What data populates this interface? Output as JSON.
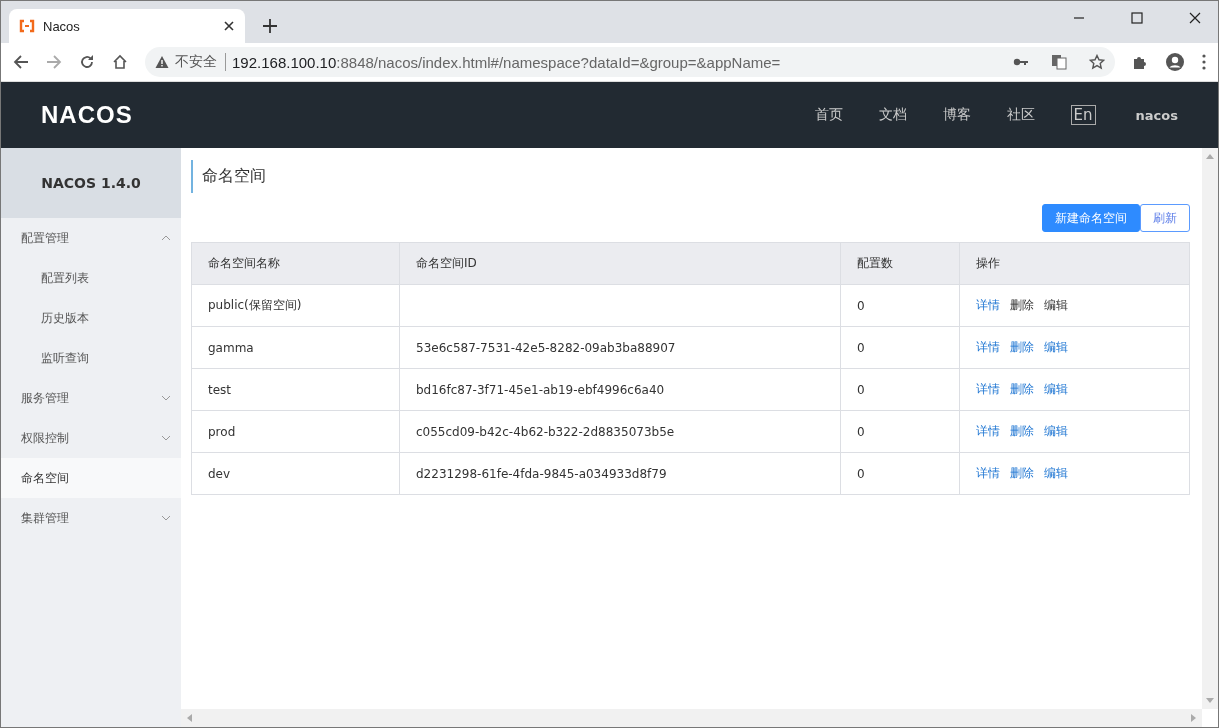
{
  "browser": {
    "tab_title": "Nacos",
    "security_label": "不安全",
    "url_host": "192.168.100.10",
    "url_rest": ":8848/nacos/index.html#/namespace?dataId=&group=&appName="
  },
  "header": {
    "logo": "NACOS",
    "nav": [
      "首页",
      "文档",
      "博客",
      "社区"
    ],
    "language": "En",
    "user": "nacos"
  },
  "sidebar": {
    "version": "NACOS 1.4.0",
    "items": [
      {
        "label": "配置管理",
        "expanded": true,
        "selected": false,
        "children": [
          {
            "label": "配置列表",
            "selected": false
          },
          {
            "label": "历史版本",
            "selected": false
          },
          {
            "label": "监听查询",
            "selected": false
          }
        ]
      },
      {
        "label": "服务管理",
        "expanded": false,
        "selected": false
      },
      {
        "label": "权限控制",
        "expanded": false,
        "selected": false
      },
      {
        "label": "命名空间",
        "selected": true
      },
      {
        "label": "集群管理",
        "expanded": false,
        "selected": false
      }
    ]
  },
  "page": {
    "title": "命名空间",
    "buttons": [
      {
        "label": "新建命名空间",
        "kind": "primary"
      },
      {
        "label": "刷新",
        "kind": "normal"
      }
    ]
  },
  "table": {
    "columns": [
      "命名空间名称",
      "命名空间ID",
      "配置数",
      "操作"
    ],
    "rows": [
      {
        "name": "public(保留空间)",
        "id": "",
        "count": "0",
        "actions": [
          {
            "label": "详情",
            "disabled": false
          },
          {
            "label": "删除",
            "disabled": true
          },
          {
            "label": "编辑",
            "disabled": true
          }
        ]
      },
      {
        "name": "gamma",
        "id": "53e6c587-7531-42e5-8282-09ab3ba88907",
        "count": "0",
        "actions": [
          {
            "label": "详情",
            "disabled": false
          },
          {
            "label": "删除",
            "disabled": false
          },
          {
            "label": "编辑",
            "disabled": false
          }
        ]
      },
      {
        "name": "test",
        "id": "bd16fc87-3f71-45e1-ab19-ebf4996c6a40",
        "count": "0",
        "actions": [
          {
            "label": "详情",
            "disabled": false
          },
          {
            "label": "删除",
            "disabled": false
          },
          {
            "label": "编辑",
            "disabled": false
          }
        ]
      },
      {
        "name": "prod",
        "id": "c055cd09-b42c-4b62-b322-2d8835073b5e",
        "count": "0",
        "actions": [
          {
            "label": "详情",
            "disabled": false
          },
          {
            "label": "删除",
            "disabled": false
          },
          {
            "label": "编辑",
            "disabled": false
          }
        ]
      },
      {
        "name": "dev",
        "id": "d2231298-61fe-4fda-9845-a034933d8f79",
        "count": "0",
        "actions": [
          {
            "label": "详情",
            "disabled": false
          },
          {
            "label": "删除",
            "disabled": false
          },
          {
            "label": "编辑",
            "disabled": false
          }
        ]
      }
    ]
  }
}
